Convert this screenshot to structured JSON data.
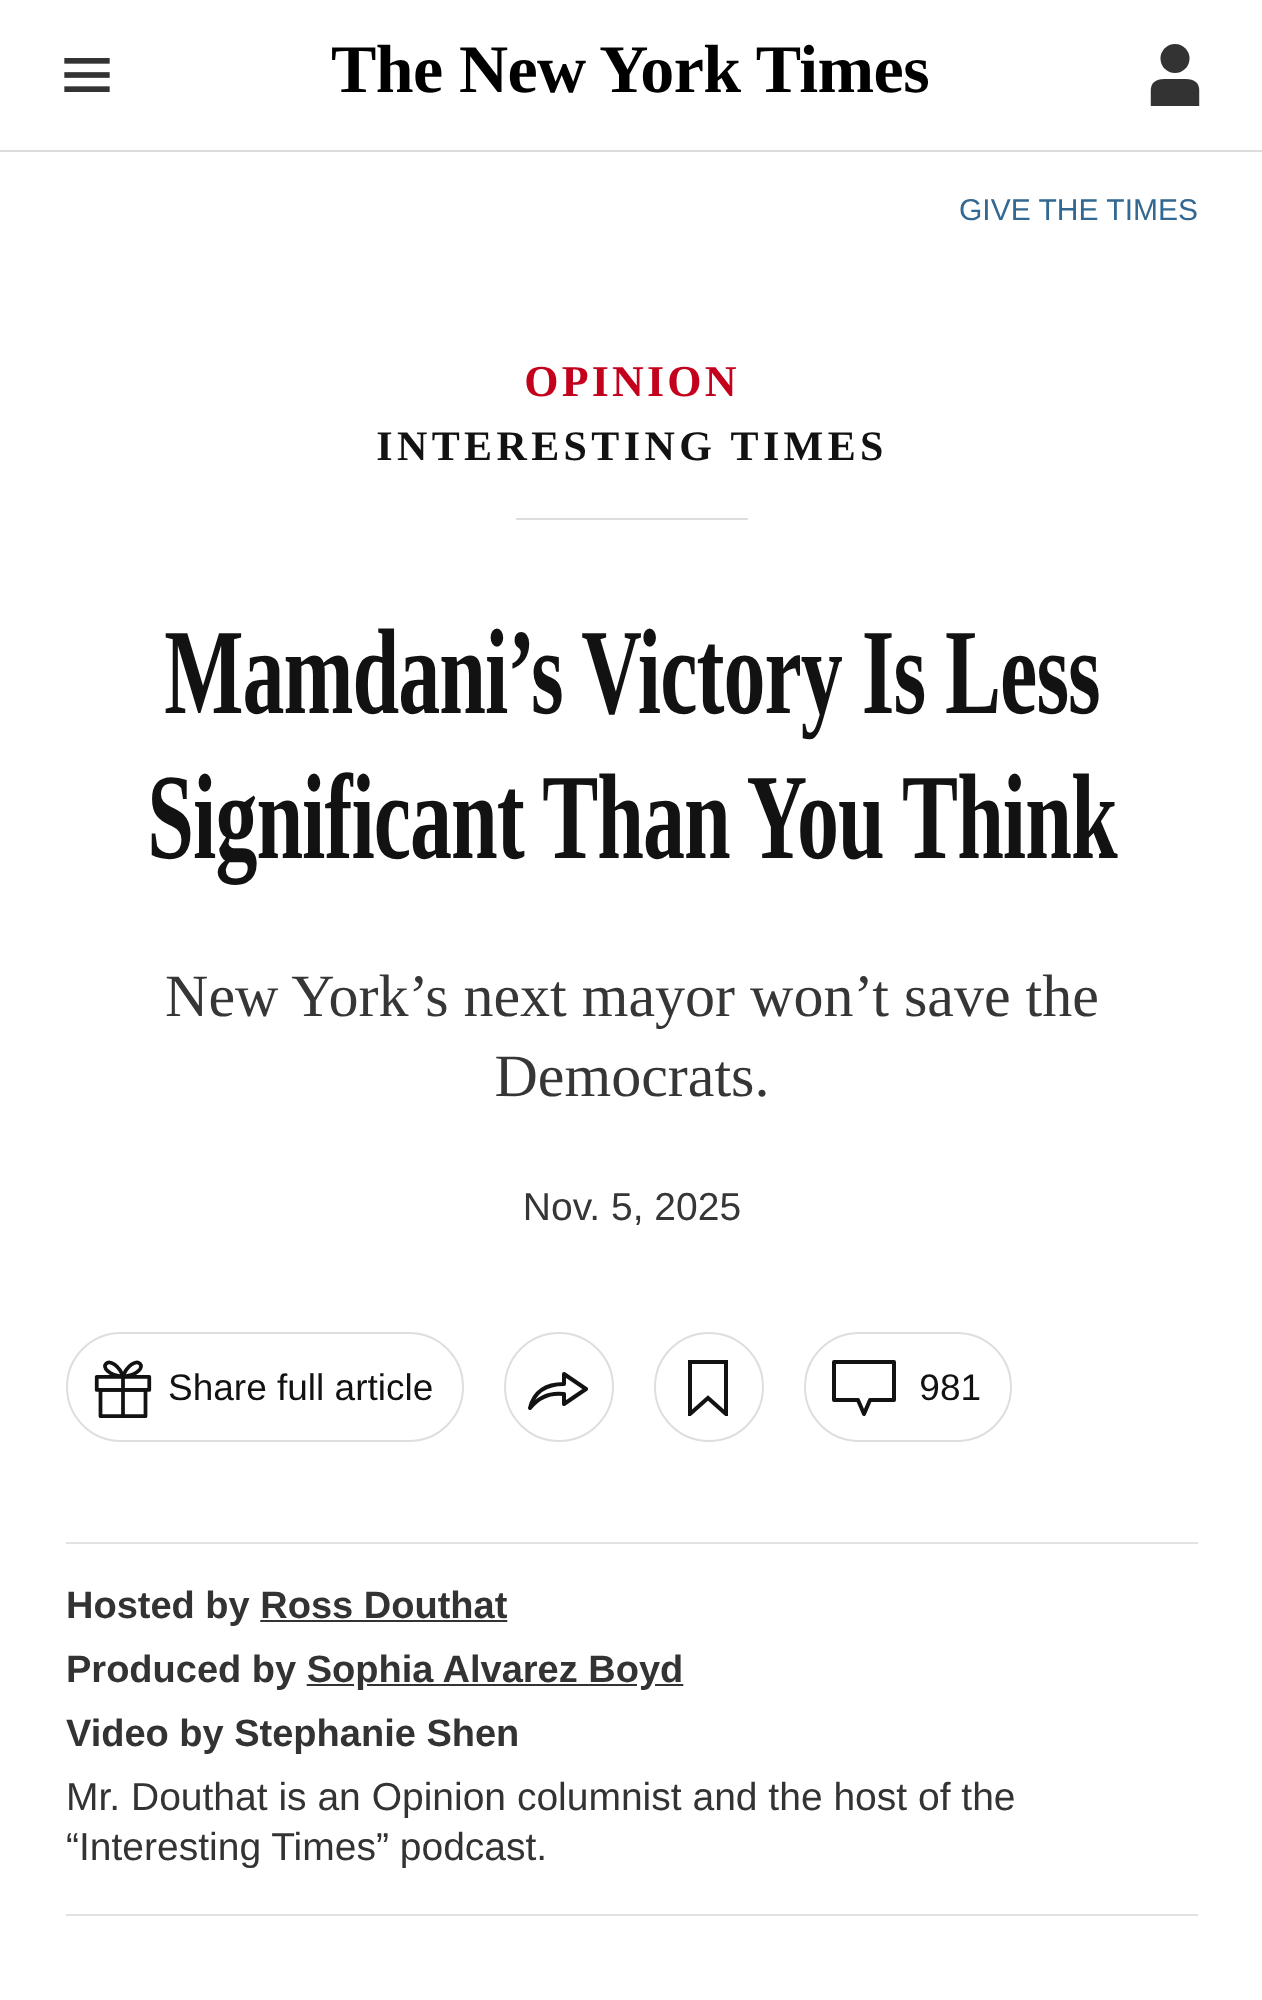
{
  "header": {
    "logo": "The New York Times"
  },
  "promo_link": "GIVE THE TIMES",
  "kicker": {
    "section": "OPINION",
    "series": "INTERESTING TIMES"
  },
  "headline": "Mamdani’s Victory Is Less Significant Than You Think",
  "summary": "New York’s next mayor won’t save the Democrats.",
  "date": "Nov. 5, 2025",
  "actions": [
    {
      "kind": "gift",
      "label": "Share full article"
    },
    {
      "kind": "share"
    },
    {
      "kind": "bookmark"
    },
    {
      "kind": "comments",
      "label": "981"
    }
  ],
  "credits": [
    {
      "role": "Hosted by",
      "name": "Ross Douthat",
      "linked": true
    },
    {
      "role": "Produced by",
      "name": "Sophia Alvarez Boyd",
      "linked": true
    },
    {
      "role": "Video by",
      "name": "Stephanie Shen",
      "linked": false
    }
  ],
  "bio": "Mr. Douthat is an Opinion columnist and the host of the “Interesting Times” podcast."
}
